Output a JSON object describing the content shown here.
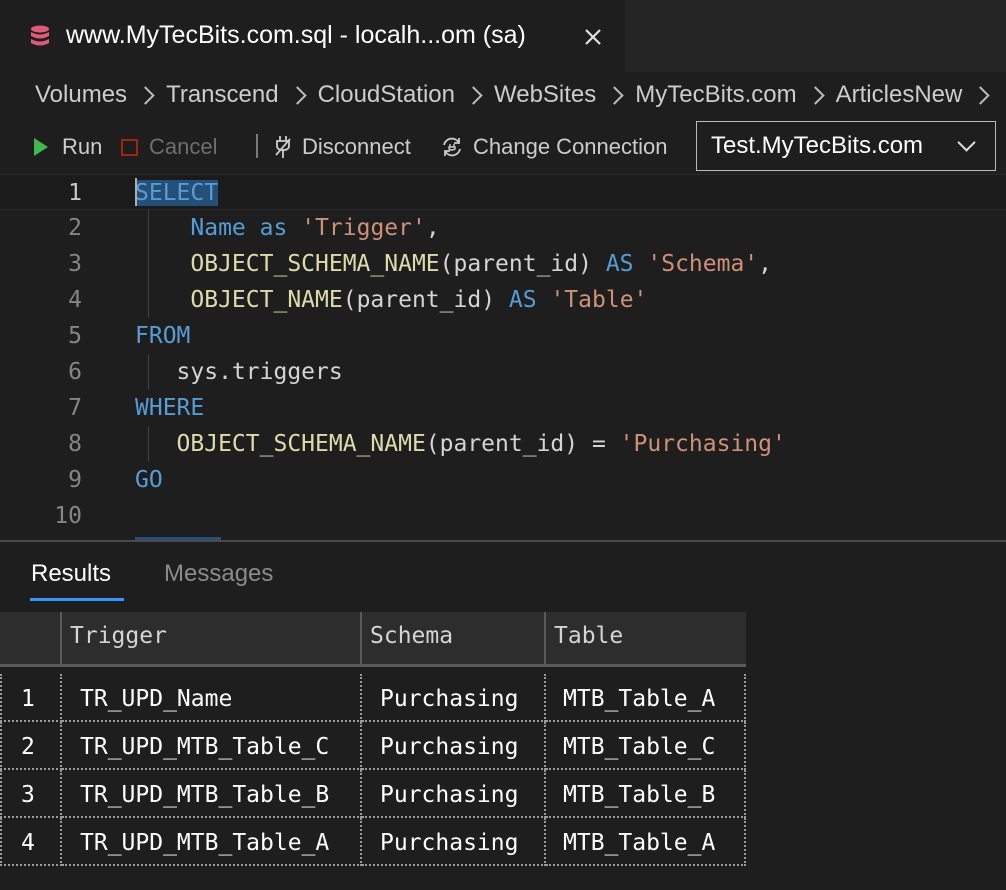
{
  "tab": {
    "title": "www.MyTecBits.com.sql - localh...om (sa)",
    "icon": "database-icon",
    "close_icon": "close-icon"
  },
  "breadcrumb": [
    "Volumes",
    "Transcend",
    "CloudStation",
    "WebSites",
    "MyTecBits.com",
    "ArticlesNew"
  ],
  "toolbar": {
    "run_label": "Run",
    "cancel_label": "Cancel",
    "disconnect_label": "Disconnect",
    "change_connection_label": "Change Connection",
    "connection_value": "Test.MyTecBits.com"
  },
  "editor": {
    "line_numbers": [
      "1",
      "2",
      "3",
      "4",
      "5",
      "6",
      "7",
      "8",
      "9",
      "10"
    ],
    "lines": [
      [
        {
          "t": "SELECT",
          "c": "kw sel-select"
        }
      ],
      [
        {
          "t": "    ",
          "c": "txt"
        },
        {
          "t": "Name",
          "c": "kw"
        },
        {
          "t": " ",
          "c": "txt"
        },
        {
          "t": "as",
          "c": "kw"
        },
        {
          "t": " ",
          "c": "txt"
        },
        {
          "t": "'Trigger'",
          "c": "str"
        },
        {
          "t": ",",
          "c": "txt"
        }
      ],
      [
        {
          "t": "    ",
          "c": "txt"
        },
        {
          "t": "OBJECT_SCHEMA_NAME",
          "c": "fn"
        },
        {
          "t": "(parent_id) ",
          "c": "txt"
        },
        {
          "t": "AS",
          "c": "kw"
        },
        {
          "t": " ",
          "c": "txt"
        },
        {
          "t": "'Schema'",
          "c": "str"
        },
        {
          "t": ",",
          "c": "txt"
        }
      ],
      [
        {
          "t": "    ",
          "c": "txt"
        },
        {
          "t": "OBJECT_NAME",
          "c": "fn"
        },
        {
          "t": "(parent_id) ",
          "c": "txt"
        },
        {
          "t": "AS",
          "c": "kw"
        },
        {
          "t": " ",
          "c": "txt"
        },
        {
          "t": "'Table'",
          "c": "str"
        }
      ],
      [
        {
          "t": "FROM",
          "c": "kw"
        }
      ],
      [
        {
          "t": "   sys.triggers",
          "c": "txt"
        }
      ],
      [
        {
          "t": "WHERE",
          "c": "kw"
        }
      ],
      [
        {
          "t": "   ",
          "c": "txt"
        },
        {
          "t": "OBJECT_SCHEMA_NAME",
          "c": "fn"
        },
        {
          "t": "(parent_id) = ",
          "c": "txt"
        },
        {
          "t": "'Purchasing'",
          "c": "str"
        }
      ],
      [
        {
          "t": "GO",
          "c": "kw"
        }
      ],
      []
    ]
  },
  "results": {
    "tab_results": "Results",
    "tab_messages": "Messages",
    "columns": [
      "Trigger",
      "Schema",
      "Table"
    ],
    "rows": [
      [
        "1",
        "TR_UPD_Name",
        "Purchasing",
        "MTB_Table_A"
      ],
      [
        "2",
        "TR_UPD_MTB_Table_C",
        "Purchasing",
        "MTB_Table_C"
      ],
      [
        "3",
        "TR_UPD_MTB_Table_B",
        "Purchasing",
        "MTB_Table_B"
      ],
      [
        "4",
        "TR_UPD_MTB_Table_A",
        "Purchasing",
        "MTB_Table_A"
      ]
    ]
  },
  "colors": {
    "keyword": "#569cd6",
    "function": "#dcdcaa",
    "string": "#ce9178",
    "accent": "#3794ff",
    "run_green": "#3fb950"
  }
}
